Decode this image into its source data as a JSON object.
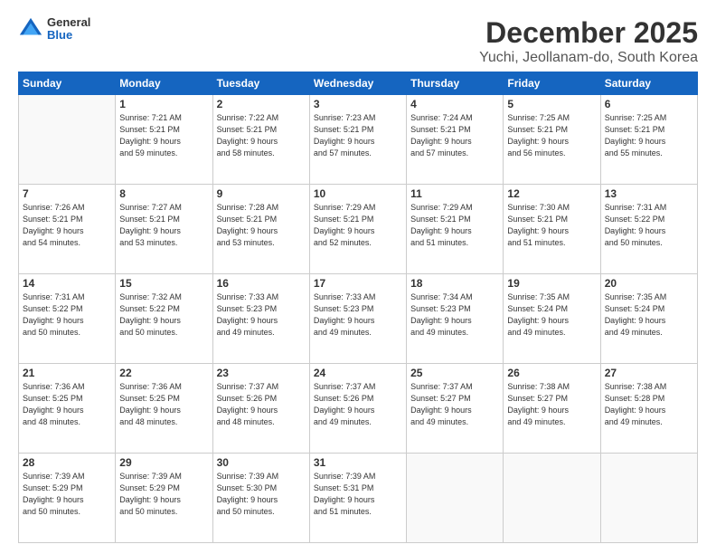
{
  "header": {
    "logo": {
      "general": "General",
      "blue": "Blue"
    },
    "title": "December 2025",
    "location": "Yuchi, Jeollanam-do, South Korea"
  },
  "calendar": {
    "days_of_week": [
      "Sunday",
      "Monday",
      "Tuesday",
      "Wednesday",
      "Thursday",
      "Friday",
      "Saturday"
    ],
    "weeks": [
      [
        {
          "day": "",
          "info": ""
        },
        {
          "day": "1",
          "info": "Sunrise: 7:21 AM\nSunset: 5:21 PM\nDaylight: 9 hours\nand 59 minutes."
        },
        {
          "day": "2",
          "info": "Sunrise: 7:22 AM\nSunset: 5:21 PM\nDaylight: 9 hours\nand 58 minutes."
        },
        {
          "day": "3",
          "info": "Sunrise: 7:23 AM\nSunset: 5:21 PM\nDaylight: 9 hours\nand 57 minutes."
        },
        {
          "day": "4",
          "info": "Sunrise: 7:24 AM\nSunset: 5:21 PM\nDaylight: 9 hours\nand 57 minutes."
        },
        {
          "day": "5",
          "info": "Sunrise: 7:25 AM\nSunset: 5:21 PM\nDaylight: 9 hours\nand 56 minutes."
        },
        {
          "day": "6",
          "info": "Sunrise: 7:25 AM\nSunset: 5:21 PM\nDaylight: 9 hours\nand 55 minutes."
        }
      ],
      [
        {
          "day": "7",
          "info": "Sunrise: 7:26 AM\nSunset: 5:21 PM\nDaylight: 9 hours\nand 54 minutes."
        },
        {
          "day": "8",
          "info": "Sunrise: 7:27 AM\nSunset: 5:21 PM\nDaylight: 9 hours\nand 53 minutes."
        },
        {
          "day": "9",
          "info": "Sunrise: 7:28 AM\nSunset: 5:21 PM\nDaylight: 9 hours\nand 53 minutes."
        },
        {
          "day": "10",
          "info": "Sunrise: 7:29 AM\nSunset: 5:21 PM\nDaylight: 9 hours\nand 52 minutes."
        },
        {
          "day": "11",
          "info": "Sunrise: 7:29 AM\nSunset: 5:21 PM\nDaylight: 9 hours\nand 51 minutes."
        },
        {
          "day": "12",
          "info": "Sunrise: 7:30 AM\nSunset: 5:21 PM\nDaylight: 9 hours\nand 51 minutes."
        },
        {
          "day": "13",
          "info": "Sunrise: 7:31 AM\nSunset: 5:22 PM\nDaylight: 9 hours\nand 50 minutes."
        }
      ],
      [
        {
          "day": "14",
          "info": "Sunrise: 7:31 AM\nSunset: 5:22 PM\nDaylight: 9 hours\nand 50 minutes."
        },
        {
          "day": "15",
          "info": "Sunrise: 7:32 AM\nSunset: 5:22 PM\nDaylight: 9 hours\nand 50 minutes."
        },
        {
          "day": "16",
          "info": "Sunrise: 7:33 AM\nSunset: 5:23 PM\nDaylight: 9 hours\nand 49 minutes."
        },
        {
          "day": "17",
          "info": "Sunrise: 7:33 AM\nSunset: 5:23 PM\nDaylight: 9 hours\nand 49 minutes."
        },
        {
          "day": "18",
          "info": "Sunrise: 7:34 AM\nSunset: 5:23 PM\nDaylight: 9 hours\nand 49 minutes."
        },
        {
          "day": "19",
          "info": "Sunrise: 7:35 AM\nSunset: 5:24 PM\nDaylight: 9 hours\nand 49 minutes."
        },
        {
          "day": "20",
          "info": "Sunrise: 7:35 AM\nSunset: 5:24 PM\nDaylight: 9 hours\nand 49 minutes."
        }
      ],
      [
        {
          "day": "21",
          "info": "Sunrise: 7:36 AM\nSunset: 5:25 PM\nDaylight: 9 hours\nand 48 minutes."
        },
        {
          "day": "22",
          "info": "Sunrise: 7:36 AM\nSunset: 5:25 PM\nDaylight: 9 hours\nand 48 minutes."
        },
        {
          "day": "23",
          "info": "Sunrise: 7:37 AM\nSunset: 5:26 PM\nDaylight: 9 hours\nand 48 minutes."
        },
        {
          "day": "24",
          "info": "Sunrise: 7:37 AM\nSunset: 5:26 PM\nDaylight: 9 hours\nand 49 minutes."
        },
        {
          "day": "25",
          "info": "Sunrise: 7:37 AM\nSunset: 5:27 PM\nDaylight: 9 hours\nand 49 minutes."
        },
        {
          "day": "26",
          "info": "Sunrise: 7:38 AM\nSunset: 5:27 PM\nDaylight: 9 hours\nand 49 minutes."
        },
        {
          "day": "27",
          "info": "Sunrise: 7:38 AM\nSunset: 5:28 PM\nDaylight: 9 hours\nand 49 minutes."
        }
      ],
      [
        {
          "day": "28",
          "info": "Sunrise: 7:39 AM\nSunset: 5:29 PM\nDaylight: 9 hours\nand 50 minutes."
        },
        {
          "day": "29",
          "info": "Sunrise: 7:39 AM\nSunset: 5:29 PM\nDaylight: 9 hours\nand 50 minutes."
        },
        {
          "day": "30",
          "info": "Sunrise: 7:39 AM\nSunset: 5:30 PM\nDaylight: 9 hours\nand 50 minutes."
        },
        {
          "day": "31",
          "info": "Sunrise: 7:39 AM\nSunset: 5:31 PM\nDaylight: 9 hours\nand 51 minutes."
        },
        {
          "day": "",
          "info": ""
        },
        {
          "day": "",
          "info": ""
        },
        {
          "day": "",
          "info": ""
        }
      ]
    ]
  }
}
